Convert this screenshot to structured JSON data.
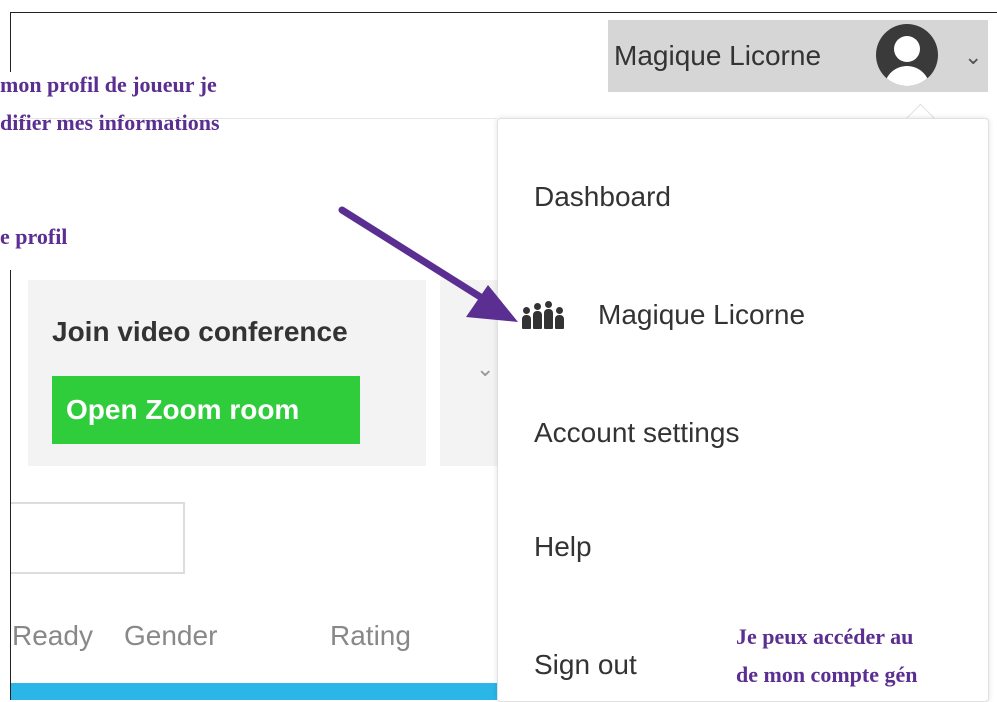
{
  "header": {
    "user_name": "Magique Licorne",
    "caret": "⌄"
  },
  "annotations": {
    "line1": "mon profil de joueur je",
    "line2": "difier mes informations",
    "line3": "e profil",
    "bottom1": "Je peux accéder au",
    "bottom2": "de mon compte gén"
  },
  "video": {
    "title": "Join video conference",
    "button": "Open Zoom room"
  },
  "table": {
    "columns": [
      "Ready",
      "Gender",
      "Rating"
    ]
  },
  "menu": {
    "items": [
      "Dashboard",
      "Magique Licorne",
      "Account settings",
      "Help",
      "Sign out"
    ]
  },
  "colors": {
    "annotation": "#5b2e91",
    "zoom_button": "#2fcc3c",
    "table_header_bar": "#2bb6e8",
    "arrow": "#5b2e91"
  },
  "icons": {
    "avatar": "avatar-icon",
    "profile": "people-group-icon",
    "dropdown": "chevron-down-icon"
  }
}
